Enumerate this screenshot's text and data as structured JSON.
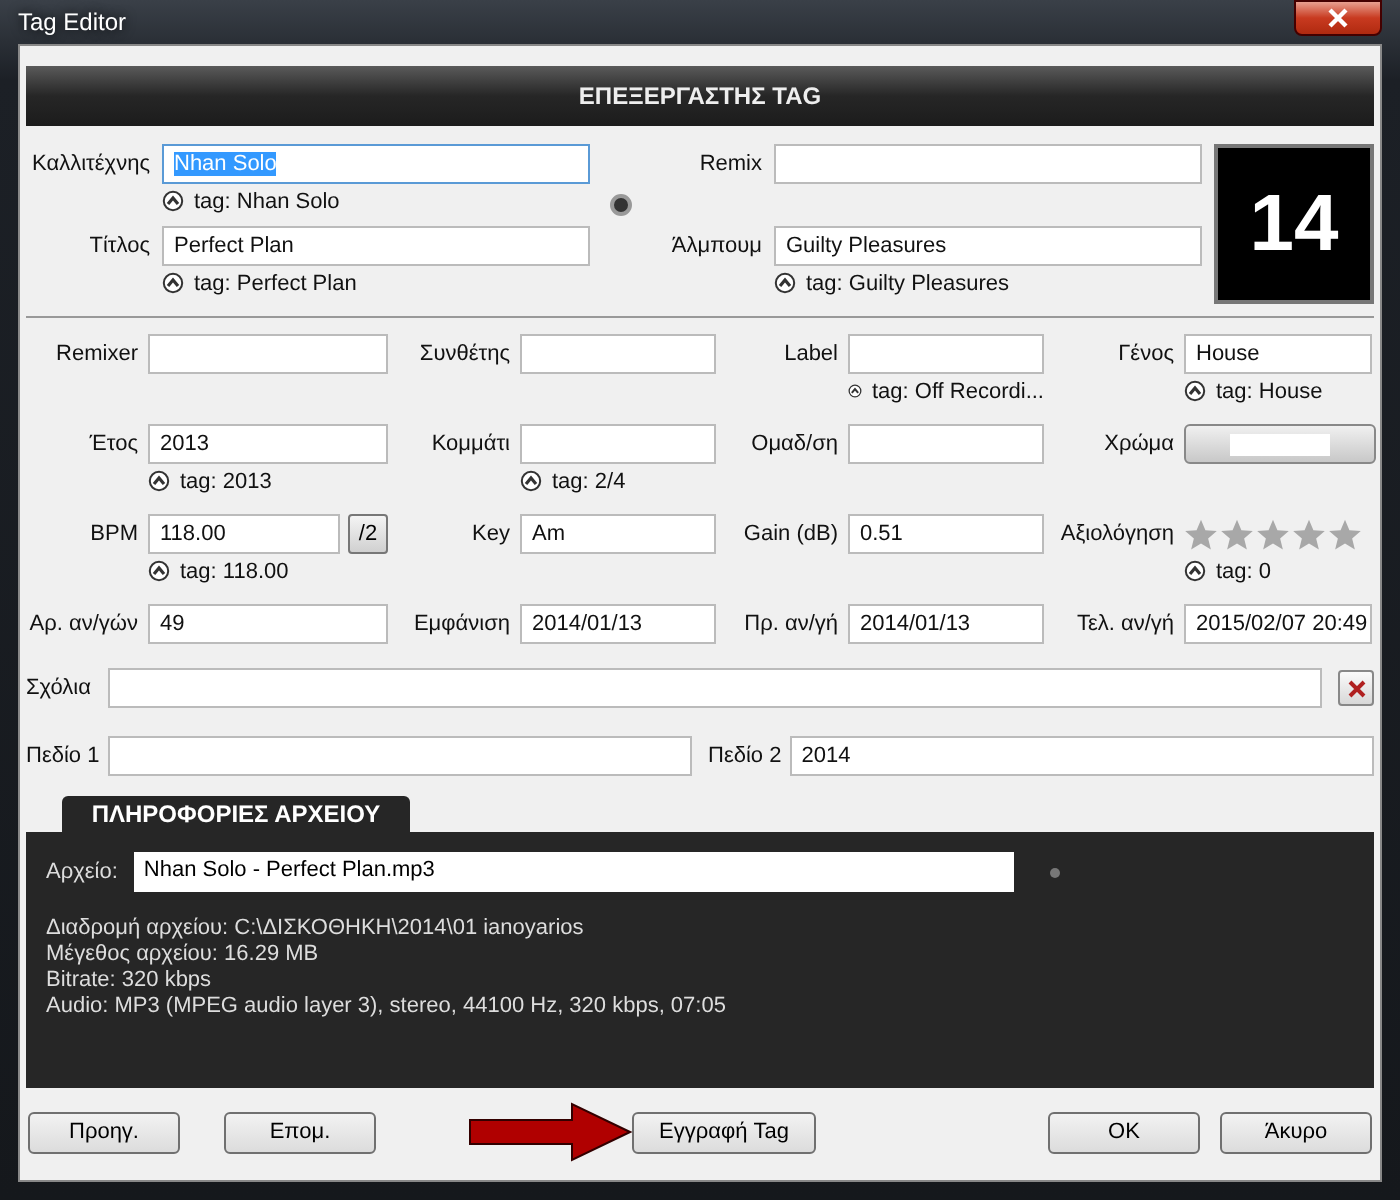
{
  "window": {
    "title": "Tag Editor"
  },
  "header": "ΕΠΕΞΕΡΓΑΣΤΗΣ TAG",
  "top_fields": [
    {
      "label": "Καλλιτέχνης",
      "value": "Nhan Solo",
      "hint": "tag: Nhan Solo",
      "text_selected": true
    },
    {
      "label": "Remix",
      "text_selected": false
    },
    {
      "label": "Τίτλος",
      "value": "Perfect Plan",
      "hint": "tag: Perfect Plan",
      "text_selected": false
    },
    {
      "label": "Άλμπουμ",
      "value": "Guilty Pleasures",
      "hint": "tag: Guilty Pleasures",
      "text_selected": false
    }
  ],
  "track_number": "14",
  "grid_fields": [
    {
      "kind": "text",
      "label": "Remixer"
    },
    {
      "kind": "text",
      "label": "Συνθέτης"
    },
    {
      "kind": "text",
      "label": "Label",
      "hint": "tag: Off Recordi..."
    },
    {
      "kind": "text",
      "label": "Γένος",
      "value": "House",
      "hint": "tag: House"
    },
    {
      "kind": "text",
      "label": "Έτος",
      "value": "2013",
      "hint": "tag: 2013"
    },
    {
      "kind": "text",
      "label": "Κομμάτι",
      "hint": "tag: 2/4"
    },
    {
      "kind": "text",
      "label": "Ομαδ/ση"
    },
    {
      "kind": "color",
      "label": "Χρώμα",
      "color": "#ffffff"
    },
    {
      "kind": "text_button",
      "label": "BPM",
      "value": "118.00",
      "button": "/2",
      "hint": "tag: 118.00"
    },
    {
      "kind": "text",
      "label": "Key",
      "value": "Am"
    },
    {
      "kind": "text",
      "label": "Gain (dB)",
      "value": "0.51"
    },
    {
      "kind": "stars",
      "label": "Αξιολόγηση",
      "stars": 0,
      "hint": "tag: 0"
    },
    {
      "kind": "text",
      "label": "Αρ. αν/γών",
      "value": "49"
    },
    {
      "kind": "text",
      "label": "Εμφάνιση",
      "value": "2014/01/13"
    },
    {
      "kind": "text",
      "label": "Πρ. αν/γή",
      "value": "2014/01/13"
    },
    {
      "kind": "text",
      "label": "Τελ. αν/γή",
      "value": "2015/02/07 20:49"
    }
  ],
  "comments": {
    "label": "Σχόλια"
  },
  "custom_fields": [
    {
      "label": "Πεδίο 1"
    },
    {
      "label": "Πεδίο 2",
      "value": "2014"
    }
  ],
  "file_info": {
    "tab": "ΠΛΗΡΟΦΟΡΙΕΣ ΑΡΧΕΙΟΥ",
    "file_label": "Αρχείο:",
    "file_name": "Nhan Solo - Perfect Plan.mp3",
    "lines": [
      "Διαδρομή αρχείου: C:\\ΔΙΣΚΟΘΗΚΗ\\2014\\01 ianoyarios",
      "Μέγεθος αρχείου: 16.29 MB",
      "Bitrate: 320 kbps",
      "Audio: MP3 (MPEG audio layer 3), stereo, 44100 Hz, 320 kbps, 07:05"
    ]
  },
  "buttons": {
    "left": [
      "Προηγ.",
      "Επομ."
    ],
    "center": "Εγγραφή Tag",
    "right": [
      "OK",
      "Άκυρο"
    ]
  }
}
